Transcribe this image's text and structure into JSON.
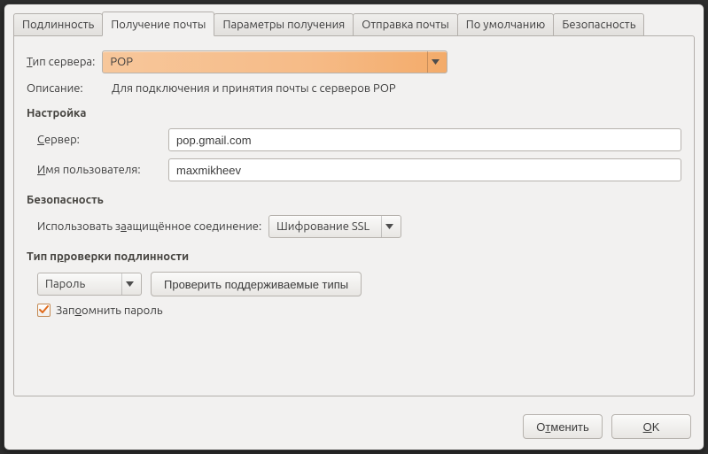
{
  "tabs": {
    "authenticity": "Подлинность",
    "receive_mail": "Получение почты",
    "receive_params": "Параметры получения",
    "send_mail": "Отправка почты",
    "defaults": "По умолчанию",
    "security": "Безопасность"
  },
  "server": {
    "type_label_pre": "Т",
    "type_label_post": "ип сервера:",
    "type_value": "POP",
    "desc_label": "Описание:",
    "desc_value": "Для подключения и принятия почты с серверов POP"
  },
  "settings": {
    "title": "Настройка",
    "server_label_pre": "С",
    "server_label_post": "ервер:",
    "server_value": "pop.gmail.com",
    "user_label_pre": "И",
    "user_label_post": "мя пользователя:",
    "user_value": "maxmikheev"
  },
  "sec": {
    "title": "Безопасность",
    "conn_pre": "Использовать з",
    "conn_post": "ащищённое соединение:",
    "conn_value": "Шифрование SSL"
  },
  "auth": {
    "title_pre": "Тип п",
    "title_post": "роверки подлинности",
    "type_value": "Пароль",
    "check_btn": "Проверить поддерживаемые типы",
    "remember_pre": "Зап",
    "remember_post": "омнить пароль"
  },
  "footer": {
    "cancel_pre": "О",
    "cancel_u": "т",
    "cancel_post": "менить",
    "ok_u": "O",
    "ok_post": "K"
  }
}
